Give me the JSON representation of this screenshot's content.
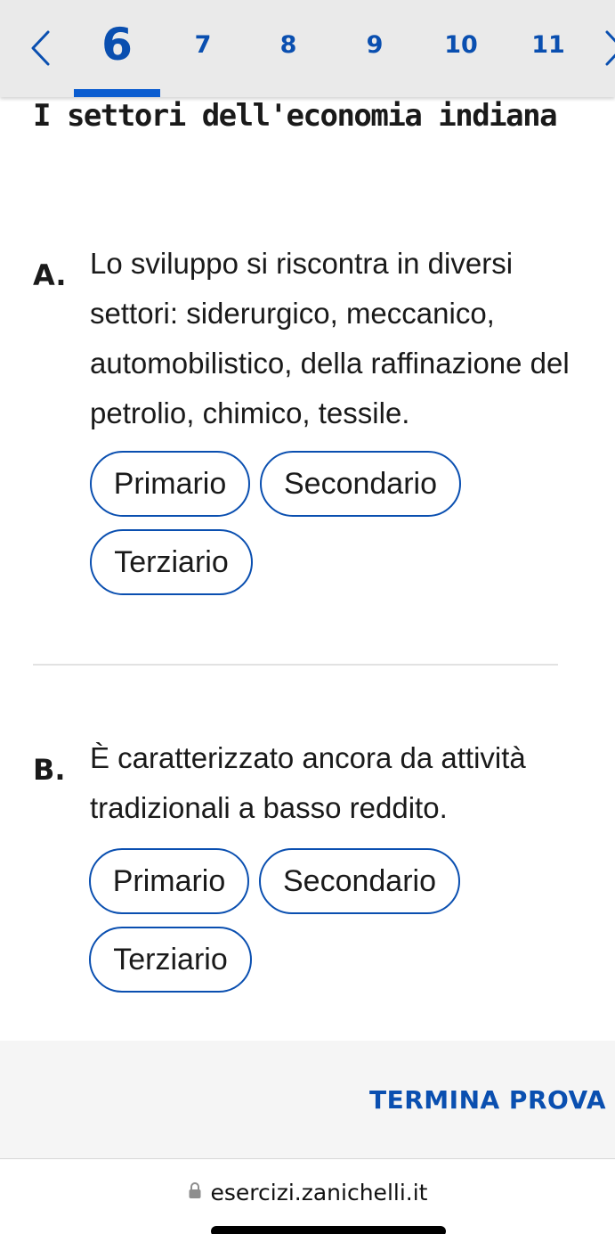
{
  "nav": {
    "prev_icon": "chevron-left-icon",
    "next_icon": "chevron-right-icon",
    "active": "6",
    "items": [
      "6",
      "7",
      "8",
      "9",
      "10",
      "11"
    ]
  },
  "title": "I settori dell'economia indiana",
  "questions": [
    {
      "letter": "A.",
      "text": "Lo sviluppo si riscontra in diversi settori: siderurgico, meccanico, automobilistico, della raffinazione del petrolio, chimico, tessile.",
      "options": [
        "Primario",
        "Secondario",
        "Terziario"
      ]
    },
    {
      "letter": "B.",
      "text": "È caratterizzato ancora da attività tradizionali a basso reddito.",
      "options": [
        "Primario",
        "Secondario",
        "Terziario"
      ]
    }
  ],
  "footer": {
    "finish_label": "TERMINA PROVA"
  },
  "browser": {
    "lock_icon": "lock-icon",
    "url": "esercizi.zanichelli.it"
  },
  "colors": {
    "accent": "#0a4fb0",
    "underline": "#0a5cd0",
    "nav_bg": "#eaeaea",
    "footer_bg": "#f5f5f5"
  }
}
